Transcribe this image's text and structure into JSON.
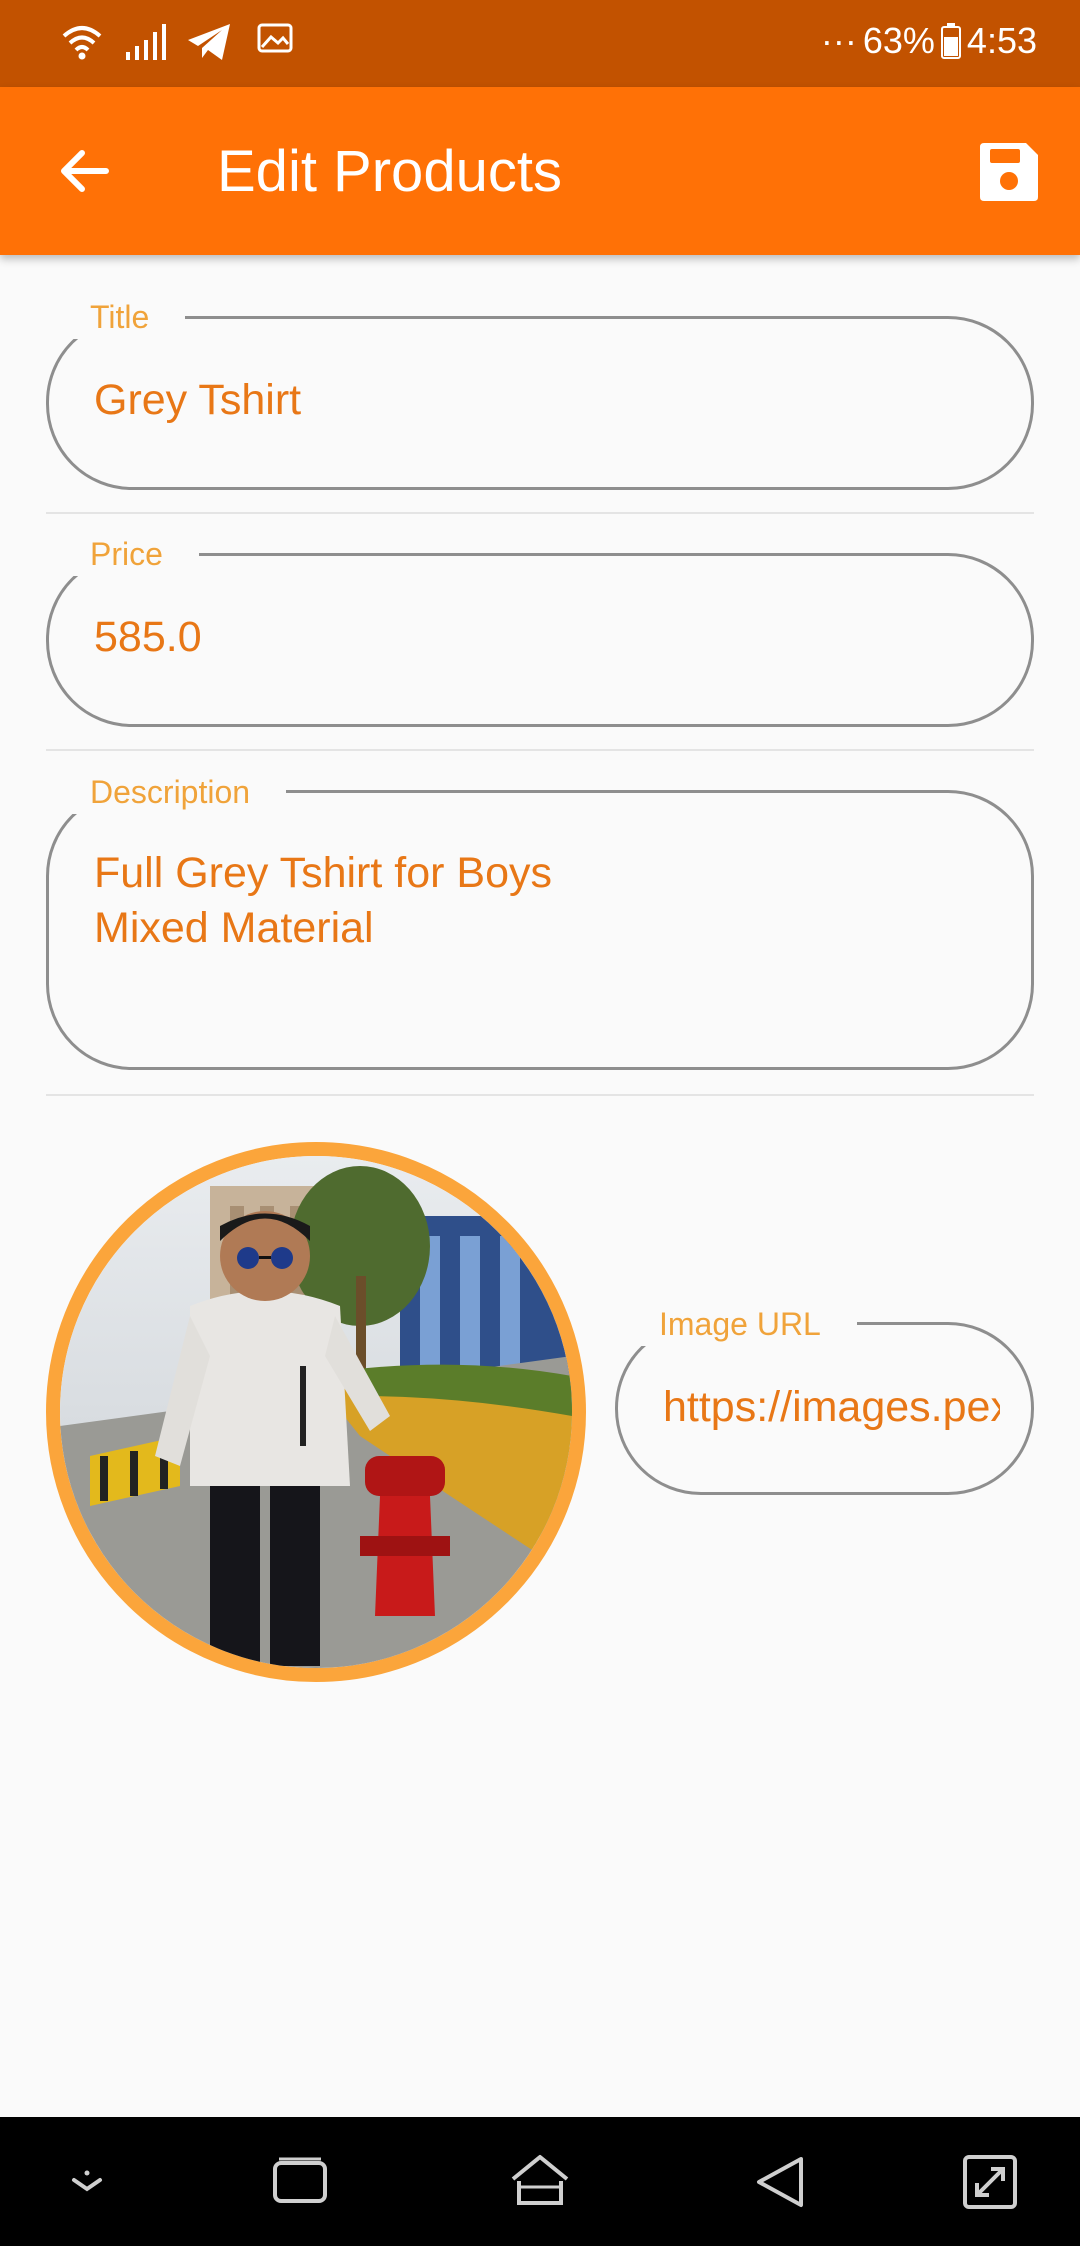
{
  "status_bar": {
    "icons": [
      "wifi-icon",
      "signal-icon",
      "telegram-icon",
      "gallery-icon"
    ],
    "overflow": "···",
    "battery_percent": "63%",
    "time": "4:53"
  },
  "app_bar": {
    "title": "Edit Products",
    "back_icon": "arrow-left-icon",
    "save_icon": "floppy-disk-icon"
  },
  "form": {
    "title": {
      "label": "Title",
      "value": "Grey Tshirt"
    },
    "price": {
      "label": "Price",
      "value": "585.0"
    },
    "description": {
      "label": "Description",
      "value": "Full Grey Tshirt for Boys\nMixed Material"
    },
    "image_url": {
      "label": "Image URL",
      "value": "https://images.pexels.com"
    }
  },
  "nav_bar": {
    "icons": [
      "hide-keyboard-icon",
      "recents-icon",
      "home-icon",
      "back-icon",
      "screenshot-icon"
    ]
  },
  "colors": {
    "status_bar": "#c25200",
    "app_bar": "#ff7106",
    "label": "#f0a33a",
    "value_text": "#e87716",
    "photo_ring": "#fba53b"
  }
}
